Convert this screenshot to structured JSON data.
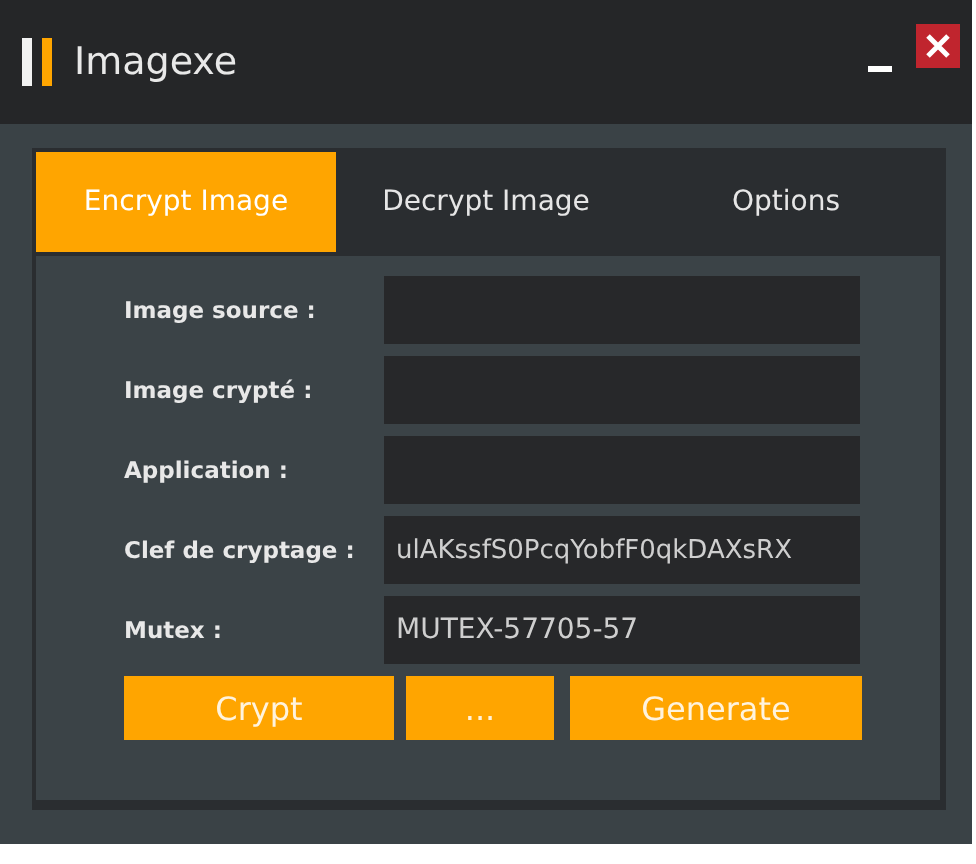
{
  "window": {
    "title": "Imagexe"
  },
  "tabs": [
    {
      "label": "Encrypt Image",
      "selected": true
    },
    {
      "label": "Decrypt Image",
      "selected": false
    },
    {
      "label": "Options",
      "selected": false
    }
  ],
  "fields": [
    {
      "label": "Image source :"
    },
    {
      "label": "Image crypté :"
    },
    {
      "label": "Application :"
    },
    {
      "label": "Clef de cryptage :",
      "value": "ulAKssfS0PcqYobfF0qkDAXsRX"
    },
    {
      "label": "Mutex :",
      "value": "MUTEX-57705-57"
    }
  ],
  "buttons": [
    {
      "label": "Crypt"
    },
    {
      "label": "..."
    },
    {
      "label": "Generate"
    }
  ]
}
